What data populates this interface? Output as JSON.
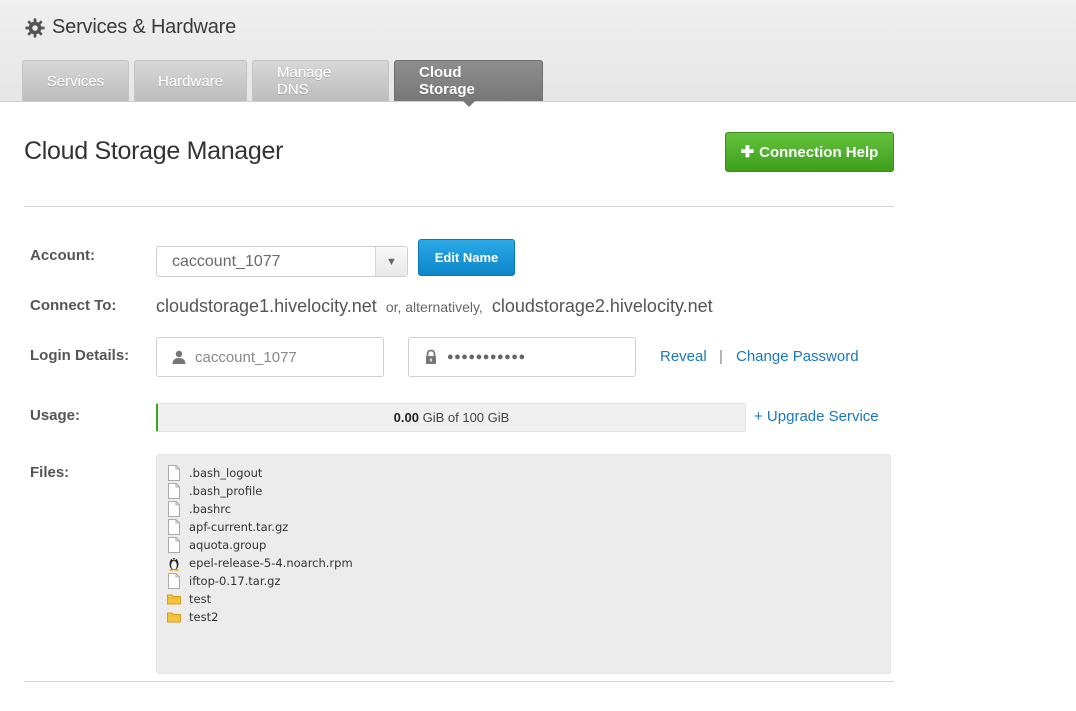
{
  "header": {
    "title": "Services & Hardware"
  },
  "tabs": [
    {
      "label": "Services"
    },
    {
      "label": "Hardware"
    },
    {
      "label": "Manage DNS"
    },
    {
      "label": "Cloud Storage",
      "active": true
    }
  ],
  "main": {
    "title": "Cloud Storage Manager",
    "help_button": "Connection Help"
  },
  "account": {
    "label": "Account:",
    "selected": "caccount_1077",
    "edit_button": "Edit Name"
  },
  "connect": {
    "label": "Connect To:",
    "host1": "cloudstorage1.hivelocity.net",
    "alt_text": "or, alternatively,",
    "host2": "cloudstorage2.hivelocity.net"
  },
  "login": {
    "label": "Login Details:",
    "username": "caccount_1077",
    "password_mask": "●●●●●●●●●●●",
    "reveal": "Reveal",
    "separator": "|",
    "change_password": "Change Password"
  },
  "usage": {
    "label": "Usage:",
    "used": "0.00",
    "rest": "GiB of 100 GiB",
    "fraction": 0.0,
    "upgrade": "+ Upgrade Service"
  },
  "files": {
    "label": "Files:",
    "items": [
      {
        "name": ".bash_logout",
        "icon": "file-icon"
      },
      {
        "name": ".bash_profile",
        "icon": "file-icon"
      },
      {
        "name": ".bashrc",
        "icon": "file-icon"
      },
      {
        "name": "apf-current.tar.gz",
        "icon": "file-icon"
      },
      {
        "name": "aquota.group",
        "icon": "file-icon"
      },
      {
        "name": "epel-release-5-4.noarch.rpm",
        "icon": "linux-penguin-icon"
      },
      {
        "name": "iftop-0.17.tar.gz",
        "icon": "file-icon"
      },
      {
        "name": "test",
        "icon": "folder-icon"
      },
      {
        "name": "test2",
        "icon": "folder-icon"
      }
    ]
  },
  "colors": {
    "help_green": "#4cae2a",
    "edit_blue": "#1398d9",
    "link_blue": "#1a77bd",
    "active_tab": "#7d7d7d"
  }
}
